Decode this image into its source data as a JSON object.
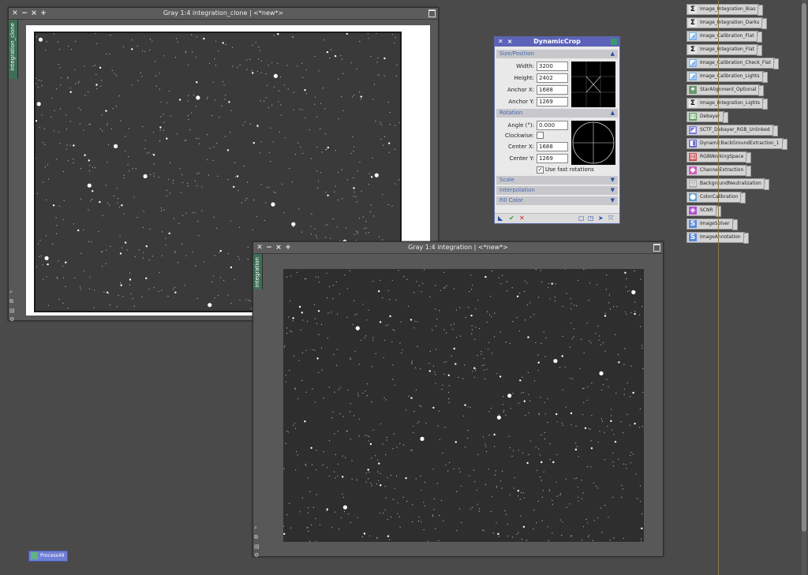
{
  "windows": {
    "clone": {
      "title": "Gray 1:4 integration_clone | <*new*>",
      "side_tab": "integration_clone"
    },
    "main": {
      "title": "Gray 1:4 integration | <*new*>",
      "side_tab": "integration"
    }
  },
  "dynamic_crop": {
    "title": "DynamicCrop",
    "sections": {
      "size_position": "Size/Position",
      "rotation": "Rotation",
      "scale": "Scale",
      "interpolation": "Interpolation",
      "fill_color": "Fill Color"
    },
    "fields": {
      "width_label": "Width:",
      "width_value": "3200",
      "height_label": "Height:",
      "height_value": "2402",
      "anchor_x_label": "Anchor X:",
      "anchor_x_value": "1688",
      "anchor_y_label": "Anchor Y:",
      "anchor_y_value": "1269",
      "angle_label": "Angle (°):",
      "angle_value": "0.000",
      "clockwise_label": "Clockwise:",
      "center_x_label": "Center X:",
      "center_x_value": "1688",
      "center_y_label": "Center Y:",
      "center_y_value": "1269",
      "fast_rotations_label": "Use fast rotations"
    }
  },
  "process_icons": [
    {
      "label": "Image_Integration_Bias",
      "icon": "sigma-icon"
    },
    {
      "label": "Image_Integration_Darks",
      "icon": "sigma-icon"
    },
    {
      "label": "Image_Calibration_Flat",
      "icon": "calibration-icon"
    },
    {
      "label": "Image_Integration_Flat",
      "icon": "sigma-icon"
    },
    {
      "label": "Image_Calibration_Check_Flat",
      "icon": "calibration-icon"
    },
    {
      "label": "Image_Calibration_Lights",
      "icon": "calibration-icon"
    },
    {
      "label": "StarAlignment_Optional",
      "icon": "star-alignment-icon"
    },
    {
      "label": "Image_Integration_Lights",
      "icon": "sigma-icon"
    },
    {
      "label": "Debayer",
      "icon": "debayer-icon"
    },
    {
      "label": "SCTF_Debayer_RGB_Unlinked",
      "icon": "stf-icon"
    },
    {
      "label": "DynamicBackGroundExtraction_1",
      "icon": "dbe-icon"
    },
    {
      "label": "RGBWorkingSpace",
      "icon": "rgb-icon"
    },
    {
      "label": "ChannelExtraction",
      "icon": "channel-icon"
    },
    {
      "label": "BackgroundNeutralization",
      "icon": "background-icon"
    },
    {
      "label": "ColorCalibration",
      "icon": "color-icon"
    },
    {
      "label": "SCNR",
      "icon": "scnr-icon"
    },
    {
      "label": "ImageSolver",
      "icon": "script-icon"
    },
    {
      "label": "ImageAnnotation",
      "icon": "script-icon"
    }
  ],
  "desktop_icon": {
    "label": "Process49"
  },
  "colors": {
    "accent": "#5b62b8",
    "tab": "#3c6f55"
  }
}
